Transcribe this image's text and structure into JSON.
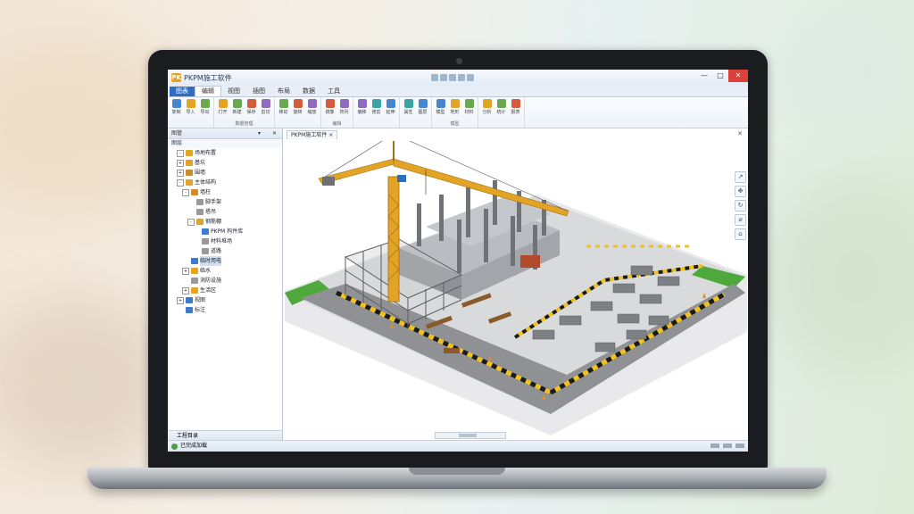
{
  "window": {
    "title": "PKPM施工软件",
    "logo": "PK",
    "controls": {
      "minimize": "—",
      "maximize": "□",
      "close": "✕"
    }
  },
  "ribbon_tabs": [
    "图表",
    "编辑",
    "视图",
    "插图",
    "布局",
    "数据",
    "工具"
  ],
  "ribbon_groups": [
    {
      "name": "",
      "buttons": [
        "复制",
        "导入",
        "导出"
      ]
    },
    {
      "name": "数据管理",
      "buttons": [
        "打开",
        "新建",
        "保存",
        "剪切"
      ]
    },
    {
      "name": "",
      "buttons": [
        "移动",
        "旋转",
        "缩放"
      ]
    },
    {
      "name": "编辑",
      "buttons": [
        "镜像",
        "阵列"
      ]
    },
    {
      "name": "",
      "buttons": [
        "偏移",
        "修剪",
        "延伸"
      ]
    },
    {
      "name": "",
      "buttons": [
        "属性",
        "图层"
      ]
    },
    {
      "name": "模型",
      "buttons": [
        "模型",
        "地形",
        "材料"
      ]
    },
    {
      "name": "",
      "buttons": [
        "分析",
        "统计",
        "报表"
      ]
    }
  ],
  "sidebar": {
    "header": "图管",
    "subheader": "图层",
    "tree": [
      {
        "label": "场地布置",
        "level": 1,
        "expand": "-",
        "color": "#e3a425"
      },
      {
        "label": "基坑",
        "level": 1,
        "expand": "+",
        "color": "#e3a425"
      },
      {
        "label": "围墙",
        "level": 1,
        "expand": "+",
        "color": "#c88a2a"
      },
      {
        "label": "主体结构",
        "level": 1,
        "expand": "-",
        "color": "#e3a425"
      },
      {
        "label": "墙柱",
        "level": 2,
        "expand": "-",
        "color": "#d58a2a"
      },
      {
        "label": "脚手架",
        "level": 3,
        "expand": "",
        "color": "#999"
      },
      {
        "label": "塔吊",
        "level": 3,
        "expand": "",
        "color": "#999"
      },
      {
        "label": "钢筋棚",
        "level": 3,
        "expand": "-",
        "color": "#e3a425"
      },
      {
        "label": "PKPM 构件库",
        "level": 4,
        "expand": "",
        "color": "#3c7ad0"
      },
      {
        "label": "材料堆场",
        "level": 4,
        "expand": "",
        "color": "#999"
      },
      {
        "label": "道路",
        "level": 4,
        "expand": "",
        "color": "#999"
      },
      {
        "label": "临时用电",
        "level": 2,
        "expand": "",
        "color": "#3c7ad0",
        "selected": true
      },
      {
        "label": "临水",
        "level": 2,
        "expand": "+",
        "color": "#e3a425"
      },
      {
        "label": "消防设施",
        "level": 2,
        "expand": "",
        "color": "#999"
      },
      {
        "label": "生活区",
        "level": 2,
        "expand": "+",
        "color": "#e3a425"
      },
      {
        "label": "视图",
        "level": 1,
        "expand": "+",
        "color": "#3c7ad0"
      },
      {
        "label": "标注",
        "level": 1,
        "expand": "",
        "color": "#3c7ad0"
      }
    ],
    "footer": "工程目录"
  },
  "document_tab": "PKPM施工软件",
  "view_tools": [
    "↗",
    "✥",
    "↻",
    "⌀",
    "⌂"
  ],
  "status": {
    "text": "已完成加载"
  }
}
